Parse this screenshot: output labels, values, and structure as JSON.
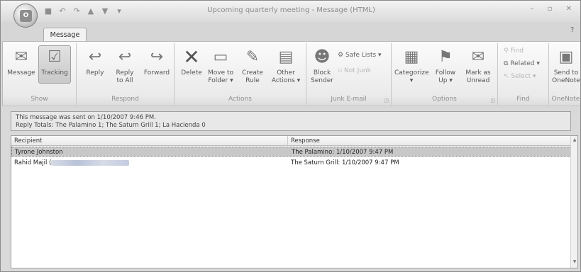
{
  "window": {
    "title": "Upcoming quarterly meeting - Message (HTML)"
  },
  "tabs": {
    "message": "Message"
  },
  "ribbon": {
    "show": {
      "label": "Show",
      "message": "Message",
      "tracking": "Tracking"
    },
    "respond": {
      "label": "Respond",
      "reply": "Reply",
      "reply_all_1": "Reply",
      "reply_all_2": "to All",
      "forward": "Forward"
    },
    "actions": {
      "label": "Actions",
      "delete": "Delete",
      "move_to_folder_1": "Move to",
      "move_to_folder_2": "Folder",
      "create_rule_1": "Create",
      "create_rule_2": "Rule",
      "other_actions_1": "Other",
      "other_actions_2": "Actions"
    },
    "junk": {
      "label": "Junk E-mail",
      "block_sender_1": "Block",
      "block_sender_2": "Sender",
      "safe_lists": "Safe Lists",
      "not_junk": "Not Junk"
    },
    "options": {
      "label": "Options",
      "categorize": "Categorize",
      "follow_up_1": "Follow",
      "follow_up_2": "Up",
      "mark_as_unread_1": "Mark as",
      "mark_as_unread_2": "Unread"
    },
    "find": {
      "label": "Find",
      "find": "Find",
      "related": "Related",
      "select": "Select"
    },
    "onenote": {
      "label": "OneNote",
      "send_1": "Send to",
      "send_2": "OneNote"
    }
  },
  "info": {
    "line1": "This message was sent on 1/10/2007 9:46 PM.",
    "line2": "Reply Totals: The Palamino 1; The Saturn Grill 1; La Hacienda 0"
  },
  "table": {
    "headers": {
      "recipient": "Recipient",
      "response": "Response"
    },
    "rows": [
      {
        "recipient": "Tyrone Johnston",
        "response": "The Palamino: 1/10/2007 9:47 PM"
      },
      {
        "recipient": "Rahid Majil (",
        "response": "The Saturn Grill: 1/10/2007 9:47 PM"
      }
    ]
  }
}
